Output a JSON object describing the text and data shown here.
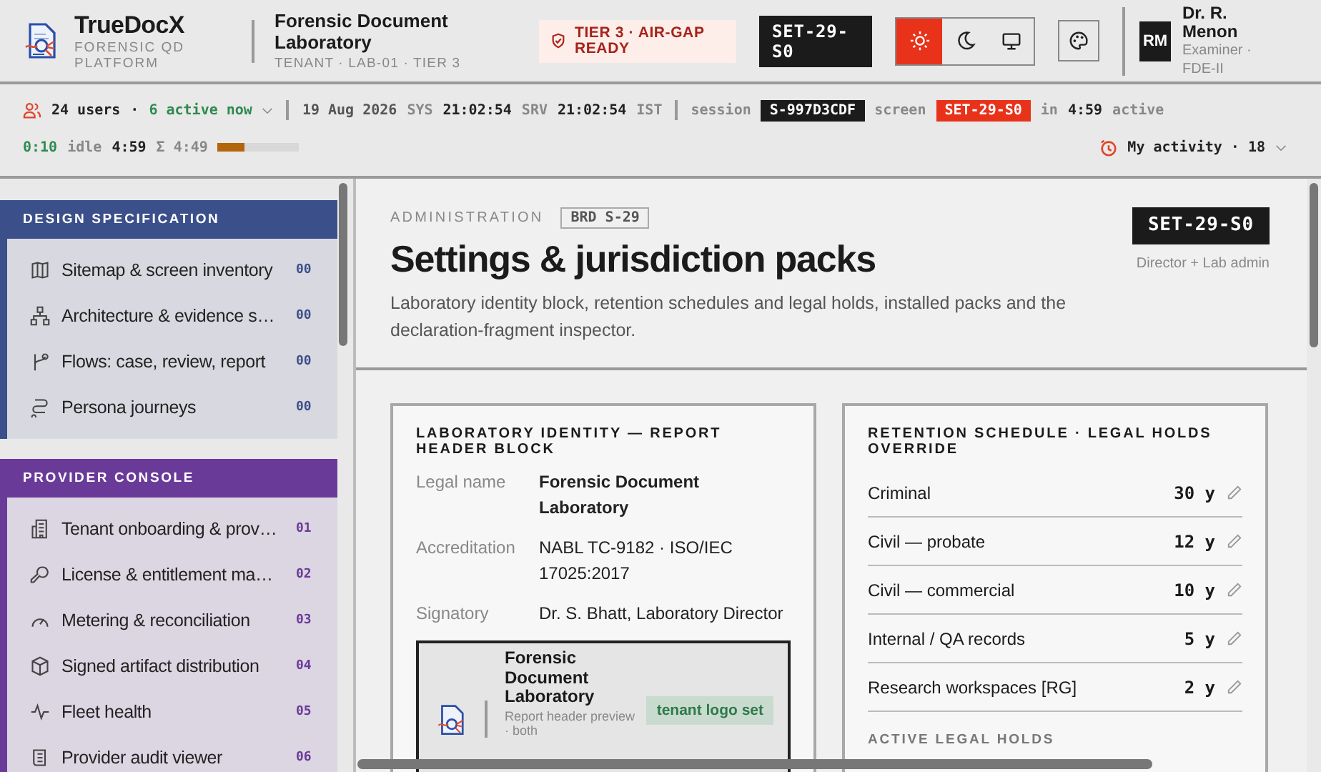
{
  "header": {
    "brand": {
      "name": "TrueDocX",
      "tagline": "FORENSIC QD PLATFORM"
    },
    "tenant": {
      "name": "Forensic Document Laboratory",
      "meta": "TENANT · LAB-01 · TIER 3"
    },
    "tier_badge": "TIER 3 · AIR-GAP READY",
    "screen_code": "SET-29-S0",
    "theme_modes": [
      {
        "kind": "light",
        "selected": true
      },
      {
        "kind": "dark",
        "selected": false
      },
      {
        "kind": "system",
        "selected": false
      }
    ],
    "user": {
      "initials": "RM",
      "name": "Dr. R. Menon",
      "role": "Examiner · FDE-II"
    }
  },
  "status_bar": {
    "users": "24 users",
    "users_separator": "·",
    "active_now": "6 active now",
    "date": "19 Aug 2026",
    "sys_label": "SYS",
    "sys_time": "21:02:54",
    "srv_label": "SRV",
    "srv_time": "21:02:54",
    "tz": "IST",
    "session_label": "session",
    "session": "S-997D3CDF",
    "screen_label": "screen",
    "screen": "SET-29-S0",
    "in_label": "in",
    "in_time": "4:59",
    "active_label": "active",
    "active_time": "0:10",
    "idle_label": "idle",
    "idle_time": "4:59",
    "total": "Σ 4:49",
    "session_meter": {
      "level": 0.32
    },
    "activity": "My activity · 18"
  },
  "sidebar": {
    "sections": [
      {
        "title": "DESIGN SPECIFICATION",
        "color": "#3b4f8a",
        "items": [
          {
            "kind": "map",
            "label": "Sitemap & screen inventory",
            "count": "00"
          },
          {
            "kind": "hierarchy",
            "label": "Architecture & evidence s…",
            "count": "00"
          },
          {
            "kind": "branch",
            "label": "Flows: case, review, report",
            "count": "00"
          },
          {
            "kind": "route",
            "label": "Persona journeys",
            "count": "00"
          }
        ]
      },
      {
        "title": "PROVIDER CONSOLE",
        "color": "#6a3a99",
        "items": [
          {
            "kind": "building",
            "label": "Tenant onboarding & prov…",
            "count": "01"
          },
          {
            "kind": "key",
            "label": "License & entitlement ma…",
            "count": "02"
          },
          {
            "kind": "gauge",
            "label": "Metering & reconciliation",
            "count": "03"
          },
          {
            "kind": "package",
            "label": "Signed artifact distribution",
            "count": "04"
          },
          {
            "kind": "pulse",
            "label": "Fleet health",
            "count": "05"
          },
          {
            "kind": "scroll",
            "label": "Provider audit viewer",
            "count": "06"
          }
        ]
      }
    ]
  },
  "page": {
    "breadcrumb": "ADMINISTRATION",
    "tag": "BRD S-29",
    "title": "Settings & jurisdiction packs",
    "description": "Laboratory identity block, retention schedules and legal holds, installed packs and the declaration-fragment inspector.",
    "screen_code": "SET-29-S0",
    "roles": "Director + Lab admin"
  },
  "identity_card": {
    "title": "LABORATORY IDENTITY — REPORT HEADER BLOCK",
    "fields": [
      {
        "label": "Legal name",
        "value": "Forensic Document Laboratory",
        "emphasis": true
      },
      {
        "label": "Accreditation",
        "value": "NABL TC-9182 · ISO/IEC 17025:2017",
        "emphasis": false
      },
      {
        "label": "Signatory",
        "value": "Dr. S. Bhatt, Laboratory Director",
        "emphasis": false
      }
    ],
    "preview": {
      "name": "Forensic Document Laboratory",
      "note": "Report header preview · both",
      "status": "tenant logo set"
    }
  },
  "retention_card": {
    "title": "RETENTION SCHEDULE · LEGAL HOLDS OVERRIDE",
    "rows": [
      {
        "label": "Criminal",
        "years": "30 y"
      },
      {
        "label": "Civil — probate",
        "years": "12 y"
      },
      {
        "label": "Civil — commercial",
        "years": "10 y"
      },
      {
        "label": "Internal / QA records",
        "years": "5 y"
      },
      {
        "label": "Research workspaces [RG]",
        "years": "2 y"
      }
    ],
    "subheading": "ACTIVE LEGAL HOLDS"
  }
}
